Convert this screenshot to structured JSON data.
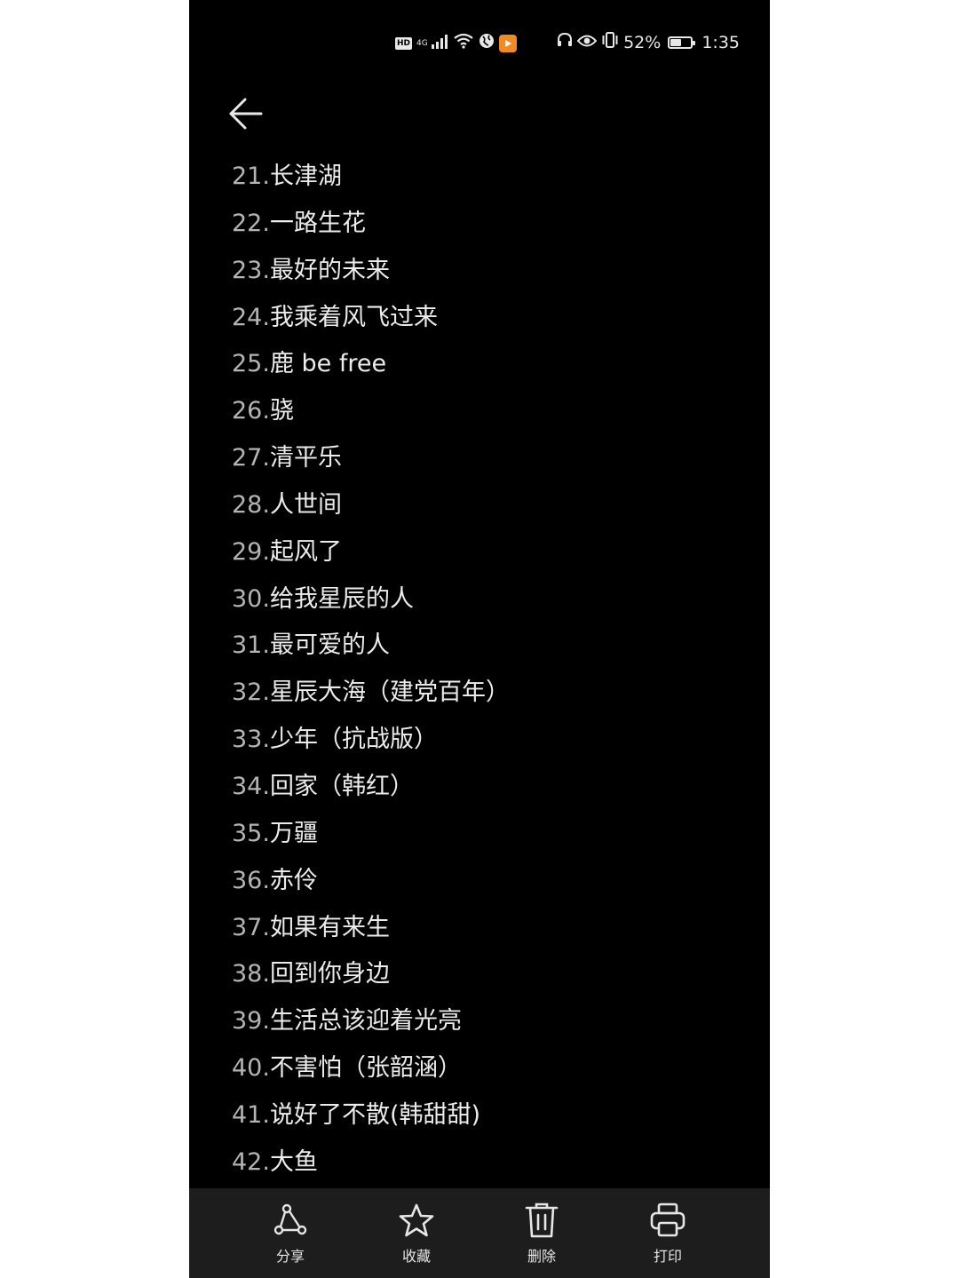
{
  "status_bar": {
    "hd": "HD",
    "network": "4G",
    "battery_percent": "52%",
    "battery_level": 0.52,
    "time": "1:35"
  },
  "songs": [
    {
      "num": "21.",
      "title": "长津湖"
    },
    {
      "num": "22.",
      "title": "一路生花"
    },
    {
      "num": "23.",
      "title": "最好的未来"
    },
    {
      "num": "24.",
      "title": "我乘着风飞过来"
    },
    {
      "num": "25.",
      "title": "鹿 be free"
    },
    {
      "num": "26.",
      "title": "骁"
    },
    {
      "num": "27.",
      "title": "清平乐"
    },
    {
      "num": "28.",
      "title": "人世间"
    },
    {
      "num": "29.",
      "title": "起风了"
    },
    {
      "num": "30.",
      "title": "给我星辰的人"
    },
    {
      "num": "31.",
      "title": "最可爱的人"
    },
    {
      "num": "32.",
      "title": "星辰大海（建党百年）"
    },
    {
      "num": "33.",
      "title": "少年（抗战版）"
    },
    {
      "num": "34.",
      "title": "回家（韩红）"
    },
    {
      "num": "35.",
      "title": "万疆"
    },
    {
      "num": "36.",
      "title": "赤伶"
    },
    {
      "num": "37.",
      "title": "如果有来生"
    },
    {
      "num": "38.",
      "title": "回到你身边"
    },
    {
      "num": "39.",
      "title": "生活总该迎着光亮"
    },
    {
      "num": "40.",
      "title": "不害怕（张韶涵）"
    },
    {
      "num": "41.",
      "title": "说好了不散(韩甜甜)"
    },
    {
      "num": "42.",
      "title": "大鱼"
    }
  ],
  "bottom_bar": {
    "share": "分享",
    "favorite": "收藏",
    "delete": "删除",
    "print": "打印"
  },
  "colors": {
    "background": "#000000",
    "bottom_bar": "#1d1d1d",
    "text": "#ececec",
    "number": "#b4b4b4",
    "app_badge": "#f08a24"
  }
}
